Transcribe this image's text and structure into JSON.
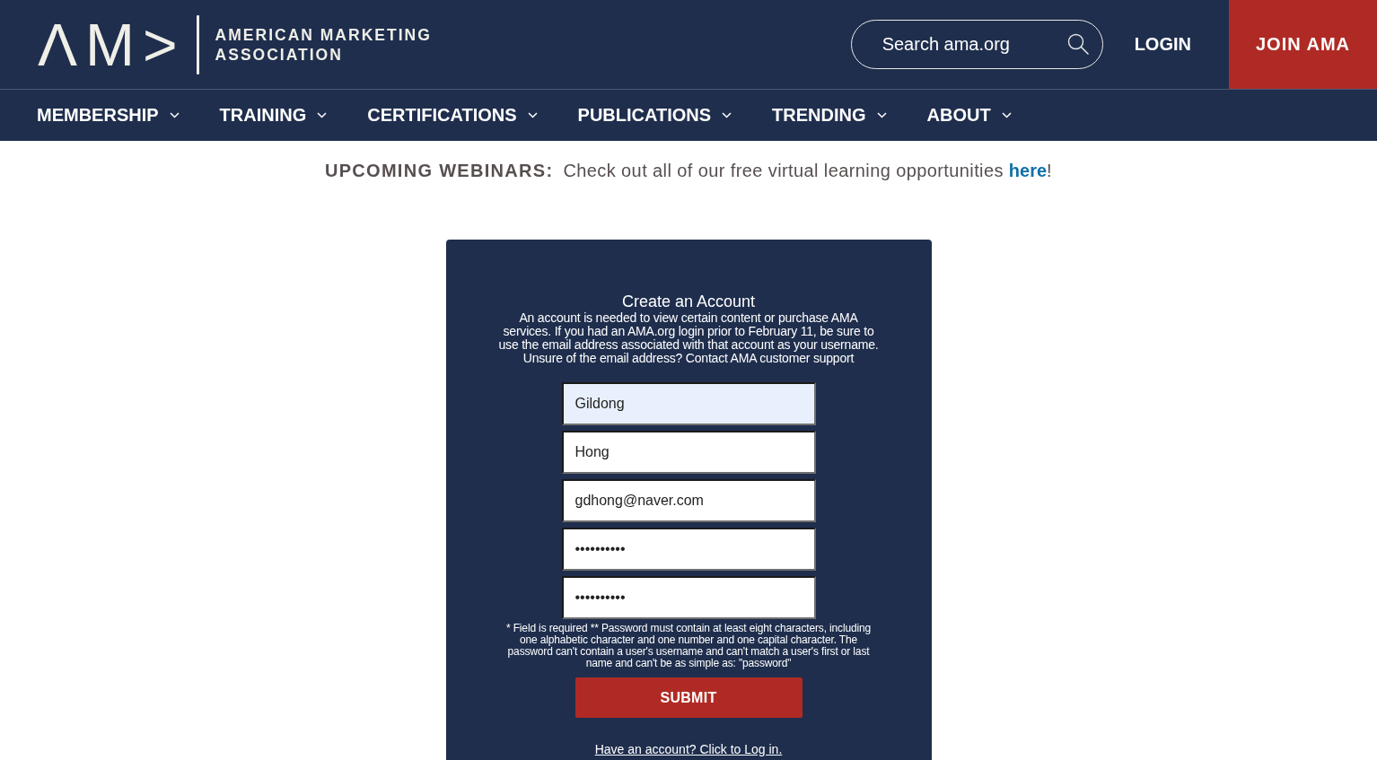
{
  "header": {
    "logo": {
      "mark": "ΛM>",
      "name": [
        "AMERICAN MARKETING",
        "ASSOCIATION"
      ]
    },
    "search": {
      "placeholder": "Search ama.org"
    },
    "login": "LOGIN",
    "join": "JOIN AMA"
  },
  "nav": [
    {
      "label": "MEMBERSHIP"
    },
    {
      "label": "TRAINING"
    },
    {
      "label": "CERTIFICATIONS"
    },
    {
      "label": "PUBLICATIONS"
    },
    {
      "label": "TRENDING"
    },
    {
      "label": "ABOUT"
    }
  ],
  "banner": {
    "label": "UPCOMING WEBINARS:",
    "text": "Check out all of our free virtual learning opportunities",
    "link": "here",
    "after": "!"
  },
  "form": {
    "title": "Create an Account",
    "description": "An account is needed to view certain content or purchase AMA services. If you had an AMA.org login prior to February 11, be sure to use the email address associated with that account as your username. Unsure of the email address? Contact AMA customer support",
    "fields": [
      {
        "value": "Gildong",
        "autofilled": true
      },
      {
        "value": "Hong",
        "autofilled": false
      },
      {
        "value": "gdhong@naver.com",
        "autofilled": false
      },
      {
        "value": "••••••••••",
        "autofilled": false
      },
      {
        "value": "••••••••••",
        "autofilled": false
      }
    ],
    "note": "* Field is required ** Password must contain at least eight characters, including one alphabetic character and one number and one capital character. The password can't contain a user's username and can't match a user's first or last name and can't be as simple as: \"password\"",
    "submit": "SUBMIT",
    "login_link": "Have an account? Click to Log in."
  }
}
